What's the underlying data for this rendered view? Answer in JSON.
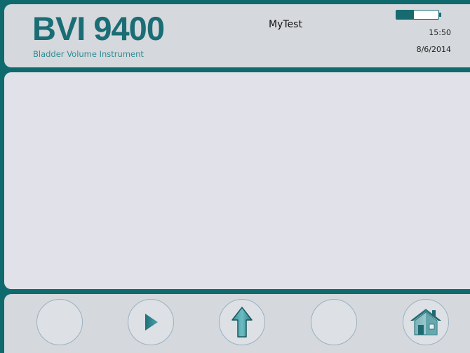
{
  "header": {
    "logo_title": "BVI 9400",
    "logo_subtitle": "Bladder Volume Instrument",
    "title": "MyTest",
    "time": "15:50",
    "date": "8/6/2014",
    "battery_level": 0.42
  },
  "footer": {
    "buttons": [
      {
        "name": "blank-button-1",
        "icon": ""
      },
      {
        "name": "play-button",
        "icon": "play-icon"
      },
      {
        "name": "up-button",
        "icon": "up-arrow-icon"
      },
      {
        "name": "blank-button-2",
        "icon": ""
      },
      {
        "name": "home-button",
        "icon": "home-icon"
      }
    ]
  },
  "colors": {
    "frame": "#0f6a6e",
    "panel": "#d5d8dc",
    "content": "#e1e2e9",
    "accent": "#1a6d74"
  }
}
